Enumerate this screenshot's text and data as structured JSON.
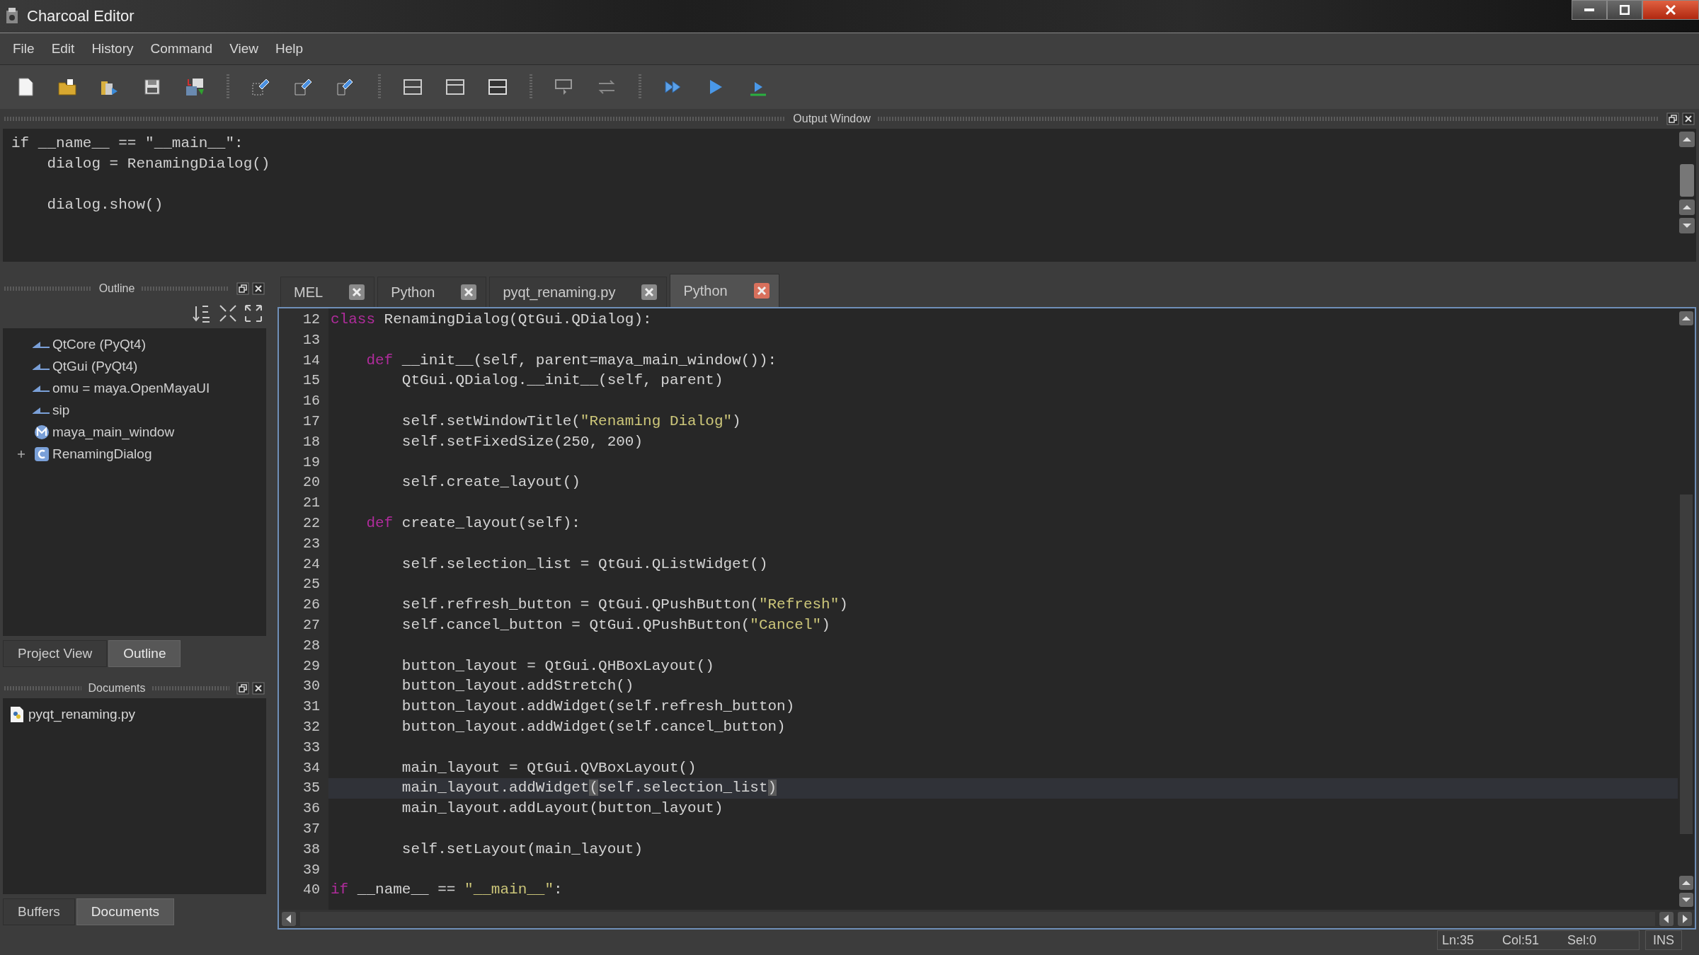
{
  "window": {
    "title": "Charcoal Editor"
  },
  "menu": [
    "File",
    "Edit",
    "History",
    "Command",
    "View",
    "Help"
  ],
  "output_window": {
    "title": "Output Window",
    "lines": [
      {
        "text": "if __name__ == \"__main__\":",
        "space_before": false
      },
      {
        "text": "    dialog = RenamingDialog()",
        "space_before": false
      },
      {
        "text": "    dialog.show()",
        "space_before": true
      }
    ]
  },
  "outline_panel": {
    "title": "Outline",
    "items": [
      {
        "kind": "import",
        "label": "QtCore (PyQt4)"
      },
      {
        "kind": "import",
        "label": "QtGui (PyQt4)"
      },
      {
        "kind": "import",
        "label": "omu = maya.OpenMayaUI"
      },
      {
        "kind": "import",
        "label": "sip"
      },
      {
        "kind": "function",
        "label": "maya_main_window"
      },
      {
        "kind": "class",
        "label": "RenamingDialog",
        "expanded": false
      }
    ]
  },
  "upper_tabs": [
    {
      "label": "Project View",
      "selected": false
    },
    {
      "label": "Outline",
      "selected": true
    }
  ],
  "documents_panel": {
    "title": "Documents",
    "items": [
      {
        "label": "pyqt_renaming.py"
      }
    ]
  },
  "lower_tabs": [
    {
      "label": "Buffers",
      "selected": false
    },
    {
      "label": "Documents",
      "selected": true
    }
  ],
  "editor": {
    "tabs": [
      {
        "label": "MEL",
        "selected": false
      },
      {
        "label": "Python",
        "selected": false
      },
      {
        "label": "pyqt_renaming.py",
        "selected": false
      },
      {
        "label": "Python",
        "selected": true
      }
    ],
    "lines": [
      {
        "number": "12",
        "current": false,
        "segments": [
          {
            "kind": "keyword",
            "text": "class"
          },
          {
            "kind": "text",
            "text": " RenamingDialog(QtGui.QDialog):"
          }
        ]
      },
      {
        "number": "13",
        "current": false
      },
      {
        "number": "14",
        "current": false,
        "segments": [
          {
            "kind": "keyword",
            "text": "    def"
          },
          {
            "kind": "text",
            "text": " __init__(self, parent=maya_main_window()):"
          }
        ]
      },
      {
        "number": "15",
        "current": false,
        "segments": [
          {
            "kind": "text",
            "text": "        QtGui.QDialog.__init__(self, parent)"
          }
        ]
      },
      {
        "number": "16",
        "current": false
      },
      {
        "number": "17",
        "current": false,
        "segments": [
          {
            "kind": "text",
            "text": "        self.setWindowTitle("
          },
          {
            "kind": "string",
            "text": "\"Renaming Dialog\""
          },
          {
            "kind": "text",
            "text": ")"
          }
        ]
      },
      {
        "number": "18",
        "current": false,
        "segments": [
          {
            "kind": "text",
            "text": "        self.setFixedSize(250, 200)"
          }
        ]
      },
      {
        "number": "19",
        "current": false
      },
      {
        "number": "20",
        "current": false,
        "segments": [
          {
            "kind": "text",
            "text": "        self.create_layout()"
          }
        ]
      },
      {
        "number": "21",
        "current": false
      },
      {
        "number": "22",
        "current": false,
        "segments": [
          {
            "kind": "keyword",
            "text": "    def"
          },
          {
            "kind": "text",
            "text": " create_layout(self):"
          }
        ]
      },
      {
        "number": "23",
        "current": false
      },
      {
        "number": "24",
        "current": false,
        "segments": [
          {
            "kind": "text",
            "text": "        self.selection_list = QtGui.QListWidget()"
          }
        ]
      },
      {
        "number": "25",
        "current": false
      },
      {
        "number": "26",
        "current": false,
        "segments": [
          {
            "kind": "text",
            "text": "        self.refresh_button = QtGui.QPushButton("
          },
          {
            "kind": "string",
            "text": "\"Refresh\""
          },
          {
            "kind": "text",
            "text": ")"
          }
        ]
      },
      {
        "number": "27",
        "current": false,
        "segments": [
          {
            "kind": "text",
            "text": "        self.cancel_button = QtGui.QPushButton("
          },
          {
            "kind": "string",
            "text": "\"Cancel\""
          },
          {
            "kind": "text",
            "text": ")"
          }
        ]
      },
      {
        "number": "28",
        "current": false
      },
      {
        "number": "29",
        "current": false,
        "segments": [
          {
            "kind": "text",
            "text": "        button_layout = QtGui.QHBoxLayout()"
          }
        ]
      },
      {
        "number": "30",
        "current": false,
        "segments": [
          {
            "kind": "text",
            "text": "        button_layout.addStretch()"
          }
        ]
      },
      {
        "number": "31",
        "current": false,
        "segments": [
          {
            "kind": "text",
            "text": "        button_layout.addWidget(self.refresh_button)"
          }
        ]
      },
      {
        "number": "32",
        "current": false,
        "segments": [
          {
            "kind": "text",
            "text": "        button_layout.addWidget(self.cancel_button)"
          }
        ]
      },
      {
        "number": "33",
        "current": false
      },
      {
        "number": "34",
        "current": false,
        "segments": [
          {
            "kind": "text",
            "text": "        main_layout = QtGui.QVBoxLayout()"
          }
        ]
      },
      {
        "number": "35",
        "current": true,
        "segments": [
          {
            "kind": "text",
            "text": "        main_layout.addWidget"
          },
          {
            "kind": "match",
            "text": "("
          },
          {
            "kind": "text",
            "text": "self.selection_list"
          },
          {
            "kind": "match",
            "text": ")"
          }
        ]
      },
      {
        "number": "36",
        "current": false,
        "segments": [
          {
            "kind": "text",
            "text": "        main_layout.addLayout(button_layout)"
          }
        ]
      },
      {
        "number": "37",
        "current": false
      },
      {
        "number": "38",
        "current": false,
        "segments": [
          {
            "kind": "text",
            "text": "        self.setLayout(main_layout)"
          }
        ]
      },
      {
        "number": "39",
        "current": false
      },
      {
        "number": "40",
        "current": false,
        "segments": [
          {
            "kind": "keyword",
            "text": "if"
          },
          {
            "kind": "text",
            "text": " __name__ == "
          },
          {
            "kind": "string",
            "text": "\"__main__\""
          },
          {
            "kind": "text",
            "text": ":"
          }
        ]
      }
    ]
  },
  "status_bar": {
    "line": "Ln:35",
    "column": "Col:51",
    "selection": "Sel:0",
    "mode": "INS"
  }
}
